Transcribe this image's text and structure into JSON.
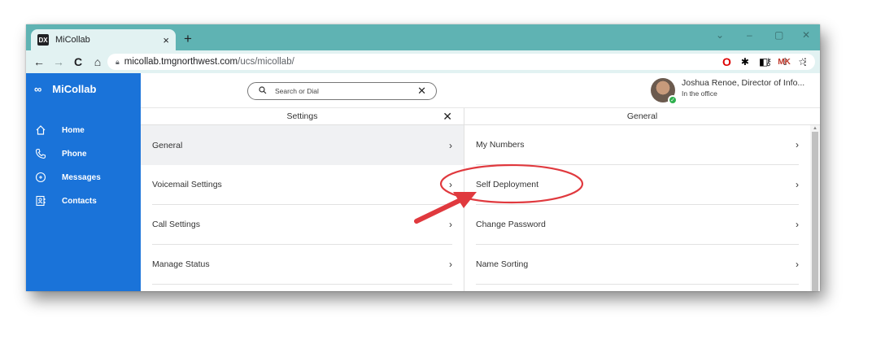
{
  "browser": {
    "tab_title": "MiCollab",
    "favicon_text": "DX",
    "new_tab": "+",
    "tab_close": "×",
    "url_host": "micollab.tmgnorthwest.com",
    "url_path": "/ucs/micollab/",
    "window_controls": [
      "⌄",
      "–",
      "▢",
      "✕"
    ],
    "nav": {
      "back": "←",
      "forward": "→",
      "reload": "C",
      "home": "⌂"
    },
    "ext_mk": "MK"
  },
  "app": {
    "brand": "MiCollab",
    "nav": [
      {
        "label": "Home",
        "icon": "home-icon"
      },
      {
        "label": "Phone",
        "icon": "phone-icon"
      },
      {
        "label": "Messages",
        "icon": "messages-icon"
      },
      {
        "label": "Contacts",
        "icon": "contacts-icon"
      }
    ],
    "search": {
      "placeholder": "Search or Dial",
      "clear": "✕"
    },
    "user": {
      "name": "Joshua Renoe, Director of Info...",
      "status": "In the office"
    }
  },
  "settings": {
    "title": "Settings",
    "close": "✕",
    "items": [
      "General",
      "Voicemail Settings",
      "Call Settings",
      "Manage Status"
    ],
    "selected_index": 0
  },
  "general": {
    "title": "General",
    "items": [
      "My Numbers",
      "Self Deployment",
      "Change Password",
      "Name Sorting"
    ],
    "highlighted_index": 1
  },
  "chevron": "›",
  "colors": {
    "sidebar": "#1a73d9",
    "chrome": "#5fb3b3",
    "annotation": "#e0393e"
  }
}
